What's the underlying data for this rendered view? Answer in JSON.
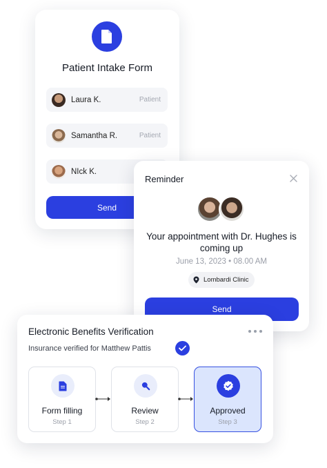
{
  "intake_form": {
    "title": "Patient Intake Form",
    "icon": "document-icon",
    "patients": [
      {
        "name": "Laura K.",
        "role": "Patient"
      },
      {
        "name": "Samantha R.",
        "role": "Patient"
      },
      {
        "name": "NIck K.",
        "role": ""
      }
    ],
    "send_label": "Send"
  },
  "reminder": {
    "title": "Reminder",
    "message": "Your appointment with Dr. Hughes is coming up",
    "datetime": "June 13, 2023 • 08.00 AM",
    "location": "Lombardi Clinic",
    "send_label": "Send"
  },
  "benefits": {
    "title": "Electronic Benefits Verification",
    "subtitle": "Insurance verified for Matthew Pattis",
    "steps": [
      {
        "label": "Form filling",
        "step": "Step 1",
        "icon": "form-icon",
        "active": false
      },
      {
        "label": "Review",
        "step": "Step 2",
        "icon": "search-icon",
        "active": false
      },
      {
        "label": "Approved",
        "step": "Step 3",
        "icon": "approved-check-icon",
        "active": true
      }
    ]
  },
  "colors": {
    "accent": "#2b3fe0",
    "active_step_bg": "#dbe5fd"
  }
}
